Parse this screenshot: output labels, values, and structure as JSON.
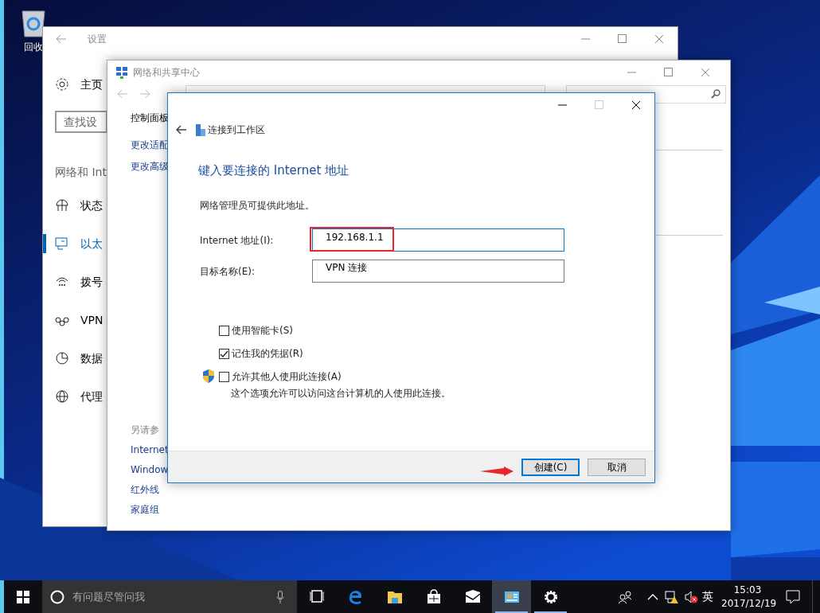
{
  "desktop": {
    "icons": [
      {
        "label": "回收"
      }
    ]
  },
  "settings_window": {
    "title": "设置",
    "home": "主页",
    "search": {
      "placeholder": "查找设"
    },
    "section": "网络和 Int",
    "nav": [
      {
        "label": "状态",
        "selected": false
      },
      {
        "label": "以太",
        "selected": true
      },
      {
        "label": "拨号",
        "selected": false
      },
      {
        "label": "VPN",
        "selected": false
      },
      {
        "label": "数据",
        "selected": false
      },
      {
        "label": "代理",
        "selected": false
      }
    ]
  },
  "network_center": {
    "title": "网络和共享中心",
    "breadcrumb": "控制面板",
    "links": [
      "更改适配",
      "更改高级"
    ],
    "see_also": {
      "heading": "另请参",
      "links": [
        "Internet",
        "Window",
        "红外线",
        "家庭组"
      ]
    }
  },
  "dialog": {
    "title": "连接到工作区",
    "heading": "键入要连接的 Internet 地址",
    "hint": "网络管理员可提供此地址。",
    "fields": [
      {
        "label": "Internet 地址(I):",
        "value": "192.168.1.1",
        "focused": true,
        "highlighted": true
      },
      {
        "label": "目标名称(E):",
        "value": "VPN 连接",
        "focused": false,
        "highlighted": false
      }
    ],
    "options": [
      {
        "label": "使用智能卡(S)",
        "checked": false,
        "shield": false
      },
      {
        "label": "记住我的凭据(R)",
        "checked": true,
        "shield": false
      },
      {
        "label": "允许其他人使用此连接(A)",
        "checked": false,
        "shield": true
      }
    ],
    "note": "这个选项允许可以访问这台计算机的人使用此连接。",
    "buttons": [
      {
        "label": "创建(C)",
        "default": true,
        "pointed": true
      },
      {
        "label": "取消",
        "default": false,
        "pointed": false
      }
    ]
  },
  "taskbar": {
    "search": {
      "placeholder": "有问题尽管问我"
    },
    "apps": [
      {
        "kind": "taskview",
        "selected": false,
        "running": false
      },
      {
        "kind": "browser",
        "selected": false,
        "running": false
      },
      {
        "kind": "folder",
        "selected": false,
        "running": false
      },
      {
        "kind": "store",
        "selected": false,
        "running": false
      },
      {
        "kind": "mail",
        "selected": false,
        "running": false
      },
      {
        "kind": "control",
        "selected": true,
        "running": true
      },
      {
        "kind": "settings",
        "selected": false,
        "running": true
      }
    ],
    "ime": "英",
    "time": "15:03",
    "date": "2017/12/19"
  }
}
